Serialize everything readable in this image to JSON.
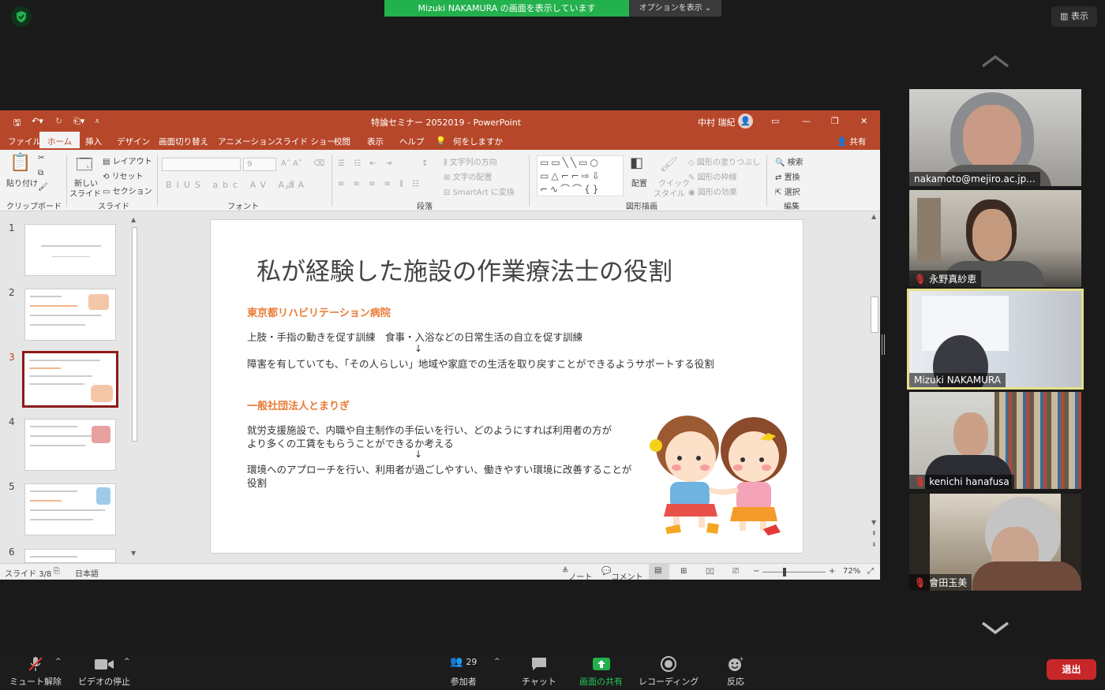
{
  "zoom": {
    "sharing_banner": "Mizuki NAKAMURA の画面を表示しています",
    "options_label": "オプションを表示",
    "view_label": "表示",
    "toolbar": {
      "mute": "ミュート解除",
      "video": "ビデオの停止",
      "participants": "参加者",
      "participant_count": "29",
      "chat": "チャット",
      "share": "画面の共有",
      "record": "レコーディング",
      "reactions": "反応",
      "leave": "退出"
    },
    "participants": [
      {
        "name": "nakamoto@mejiro.ac.jp...",
        "muted": false
      },
      {
        "name": "永野真紗恵",
        "muted": true
      },
      {
        "name": "Mizuki NAKAMURA",
        "muted": false,
        "active": true
      },
      {
        "name": "kenichi hanafusa",
        "muted": true
      },
      {
        "name": "會田玉美",
        "muted": true
      }
    ]
  },
  "ppt": {
    "title": "特論セミナー 2052019 - PowerPoint",
    "user": "中村 瑞紀",
    "tabs": [
      "ファイル",
      "ホーム",
      "挿入",
      "デザイン",
      "画面切り替え",
      "アニメーション",
      "スライド ショー",
      "校閲",
      "表示",
      "ヘルプ",
      "何をしますか"
    ],
    "share": "共有",
    "ribbon": {
      "paste": "貼り付け",
      "new_slide": "新しい",
      "new_slide2": "スライド",
      "layout": "レイアウト",
      "reset": "リセット",
      "section": "セクション",
      "font_size": "9",
      "text_direction": "文字列の方向",
      "align_text": "文字の配置",
      "smartart": "SmartArt に変換",
      "arrange": "配置",
      "quick_styles": "クイック",
      "quick_styles2": "スタイル",
      "shape_fill": "図形の塗りつぶし",
      "shape_outline": "図形の枠線",
      "shape_effects": "図形の効果",
      "find": "検索",
      "replace": "置換",
      "select": "選択",
      "groups": {
        "clipboard": "クリップボード",
        "slides": "スライド",
        "font": "フォント",
        "paragraph": "段落",
        "drawing": "図形描画",
        "editing": "編集"
      }
    },
    "thumb_numbers": [
      "1",
      "2",
      "3",
      "4",
      "5",
      "6"
    ],
    "slide": {
      "title": "私が経験した施設の作業療法士の役割",
      "heading1": "東京都リハビリテーション病院",
      "line1": "上肢・手指の動きを促す訓練　食事・入浴などの日常生活の自立を促す訓練",
      "arrow": "↓",
      "line2": "障害を有していても、「その人らしい」地域や家庭での生活を取り戻すことができるようサポートする役割",
      "heading2": "一般社団法人とまりぎ",
      "line3": "就労支援施設で、内職や自主制作の手伝いを行い、どのようにすれば利用者の方が",
      "line4": "より多くの工賃をもらうことができるか考える",
      "line5": "環境へのアプローチを行い、利用者が過ごしやすい、働きやすい環境に改善することが",
      "line6": "役割"
    },
    "status": {
      "slide_count": "スライド 3/8",
      "language": "日本語",
      "notes": "ノート",
      "comments": "コメント",
      "zoom": "72%"
    }
  }
}
